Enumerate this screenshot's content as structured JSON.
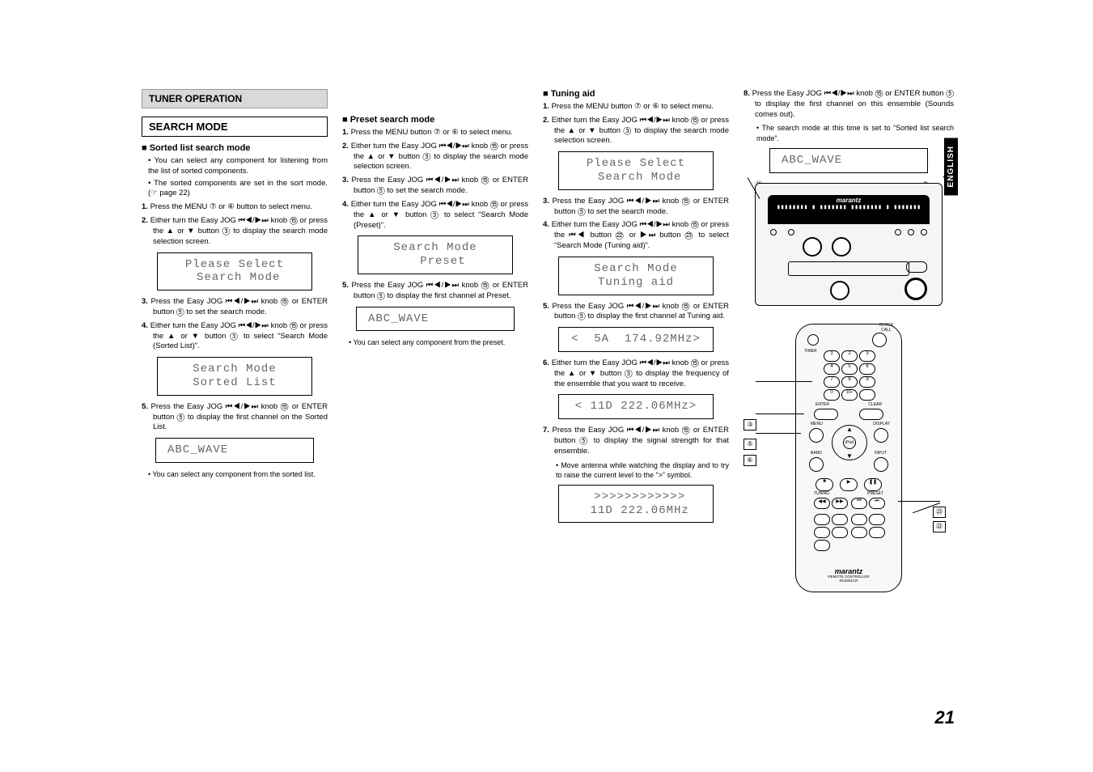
{
  "language_tab": "ENGLISH",
  "page_number": "21",
  "section_bar": "TUNER OPERATION",
  "search_mode_title": "SEARCH MODE",
  "col1": {
    "sub1": "Sorted list search mode",
    "b1": "You can select any component for listening from the list of sorted components.",
    "b2": "The sorted components are set in the sort mode. (☞ page 22)",
    "s1": "1. Press the MENU ⑦ or ⑥ button to select menu.",
    "s2": "2. Either turn the Easy JOG ⏮◀/▶⏭ knob ⑮ or press the ▲ or ▼ button ③ to display the search mode selection screen.",
    "lcd1": "Please Select\n Search Mode",
    "s3": "3. Press the Easy JOG ⏮◀/▶⏭ knob ⑮ or ENTER button ⑤ to set the search mode.",
    "s4": "4. Either turn the Easy JOG ⏮◀/▶⏭ knob ⑮ or press the ▲ or ▼ button ③ to select “Search Mode (Sorted List)”.",
    "lcd2": "Search Mode\nSorted List",
    "s5": "5. Press the Easy JOG ⏮◀/▶⏭ knob ⑮ or ENTER button ⑤ to display the first channel on the Sorted List.",
    "lcd3": "ABC_WAVE",
    "note": "You can select any component from the sorted list."
  },
  "col2": {
    "sub1": "Preset search mode",
    "s1": "1. Press the MENU button ⑦ or ⑥ to select menu.",
    "s2": "2. Either turn the Easy JOG ⏮◀/▶⏭ knob ⑮ or press the ▲ or ▼ button ③ to display the search mode selection screen.",
    "s3": "3. Press the Easy JOG ⏮◀/▶⏭ knob ⑮ or ENTER button ⑤ to set the search mode.",
    "s4": "4. Either turn the Easy JOG ⏮◀/▶⏭ knob ⑮ or press the ▲ or ▼ button ③ to select “Search Mode (Preset)”.",
    "lcd1": "Search Mode\n  Preset",
    "s5": "5. Press the Easy JOG ⏮◀/▶⏭ knob ⑮ or ENTER button ⑤ to display the first channel at Preset.",
    "lcd2": "ABC_WAVE",
    "note": "You can select any component from the preset."
  },
  "col3": {
    "sub1": "Tuning aid",
    "s1": "1. Press the MENU button ⑦ or ⑥ to select menu.",
    "s2": "2. Either turn the Easy JOG ⏮◀/▶⏭ knob ⑮ or press the ▲ or ▼ button ③ to display the search mode selection screen.",
    "lcd1": "Please Select\n Search Mode",
    "s3": "3. Press the Easy JOG ⏮◀/▶⏭ knob ⑮ or ENTER button ⑤ to set the search mode.",
    "s4": "4. Either turn the Easy JOG ⏮◀/▶⏭ knob ⑮ or press the ⏮◀ button ㉒ or ▶⏭ button ㉓ to select “Search Mode (Tuning aid)”.",
    "lcd2": "Search Mode\nTuning aid",
    "s5": "5. Press the Easy JOG ⏮◀/▶⏭ knob ⑮ or ENTER button ⑤ to display the first channel at Tuning aid.",
    "lcd3": "<  5A  174.92MHz>",
    "s6": "6. Either turn the Easy JOG ⏮◀/▶⏭ knob ⑮ or press the ▲ or ▼ button ③ to display the frequency of the ensemble that you want to receive.",
    "lcd4": "< 11D 222.06MHz>",
    "s7": "7. Press the Easy JOG ⏮◀/▶⏭ knob ⑮ or ENTER button ⑤ to display the signal strength for that ensemble.",
    "n7": "Move antenna while watching the display and to try to raise the current level to the “>” symbol.",
    "lcd5": " >>>>>>>>>>>>\n 11D 222.06MHz"
  },
  "col4": {
    "s8": "8. Press the Easy JOG ⏮◀/▶⏭ knob ⑮ or ENTER button ⑤ to display the first channel on this ensemble (Sounds comes out).",
    "n8": "The search mode at this time is set to “Sorted list search mode”.",
    "lcd1": "ABC_WAVE",
    "device_brand": "marantz",
    "device_bars": "▮▮▮▮▮▮▮▮ ▮ ▮▮▮▮▮▮▮\n▮▮▮▮▮▮▮▮ ▮ ▮▮▮▮▮▮▮",
    "callout_15": "⑮",
    "callout_7": "⑦",
    "callout_3": "③",
    "callout_5": "⑤",
    "callout_6": "⑥",
    "callout_22": "㉒",
    "callout_23": "㉓",
    "remote_brand": "marantz",
    "remote_model": "REMOTE CONTROLLER\nRC6001CR",
    "remote_labels": {
      "clock": "CLOCK\nCALL",
      "timer": "TIMER",
      "enter": "ENTER",
      "clear": "CLEAR",
      "menu": "MENU",
      "display": "DISPLAY",
      "ipod": "iPod",
      "band": "BAND",
      "input": "INPUT",
      "tuning": "TUNING",
      "preset": "PRESET"
    }
  }
}
